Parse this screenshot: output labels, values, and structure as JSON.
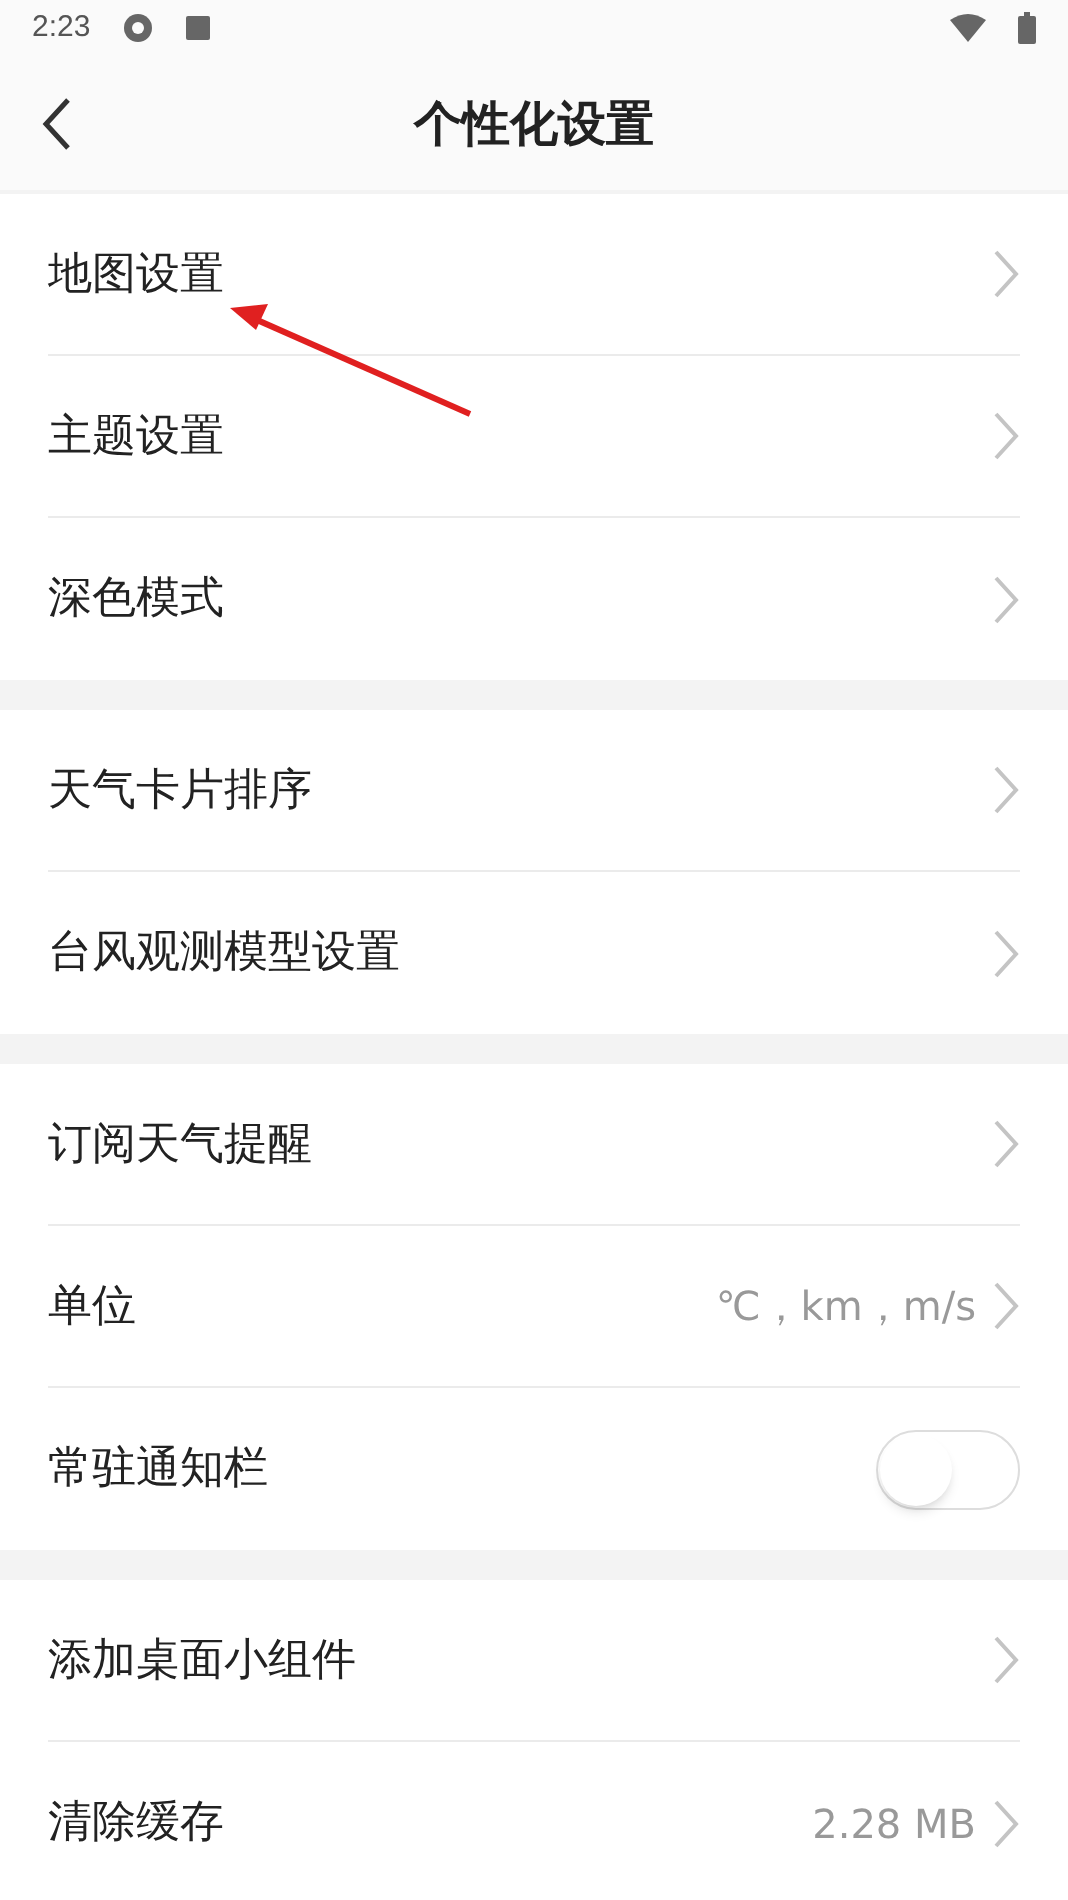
{
  "status_bar": {
    "time": "2:23"
  },
  "header": {
    "title": "个性化设置"
  },
  "groups": [
    {
      "items": [
        {
          "kind": "link",
          "label": "地图设置"
        },
        {
          "kind": "link",
          "label": "主题设置"
        },
        {
          "kind": "link",
          "label": "深色模式"
        }
      ]
    },
    {
      "items": [
        {
          "kind": "link",
          "label": "天气卡片排序"
        },
        {
          "kind": "link",
          "label": "台风观测模型设置"
        }
      ]
    },
    {
      "items": [
        {
          "kind": "link",
          "label": "订阅天气提醒"
        },
        {
          "kind": "link",
          "label": "单位",
          "value": "℃，km，m/s"
        },
        {
          "kind": "toggle",
          "label": "常驻通知栏",
          "on": false
        }
      ]
    },
    {
      "items": [
        {
          "kind": "link",
          "label": "添加桌面小组件"
        },
        {
          "kind": "link",
          "label": "清除缓存",
          "value": "2.28 MB"
        }
      ]
    }
  ]
}
